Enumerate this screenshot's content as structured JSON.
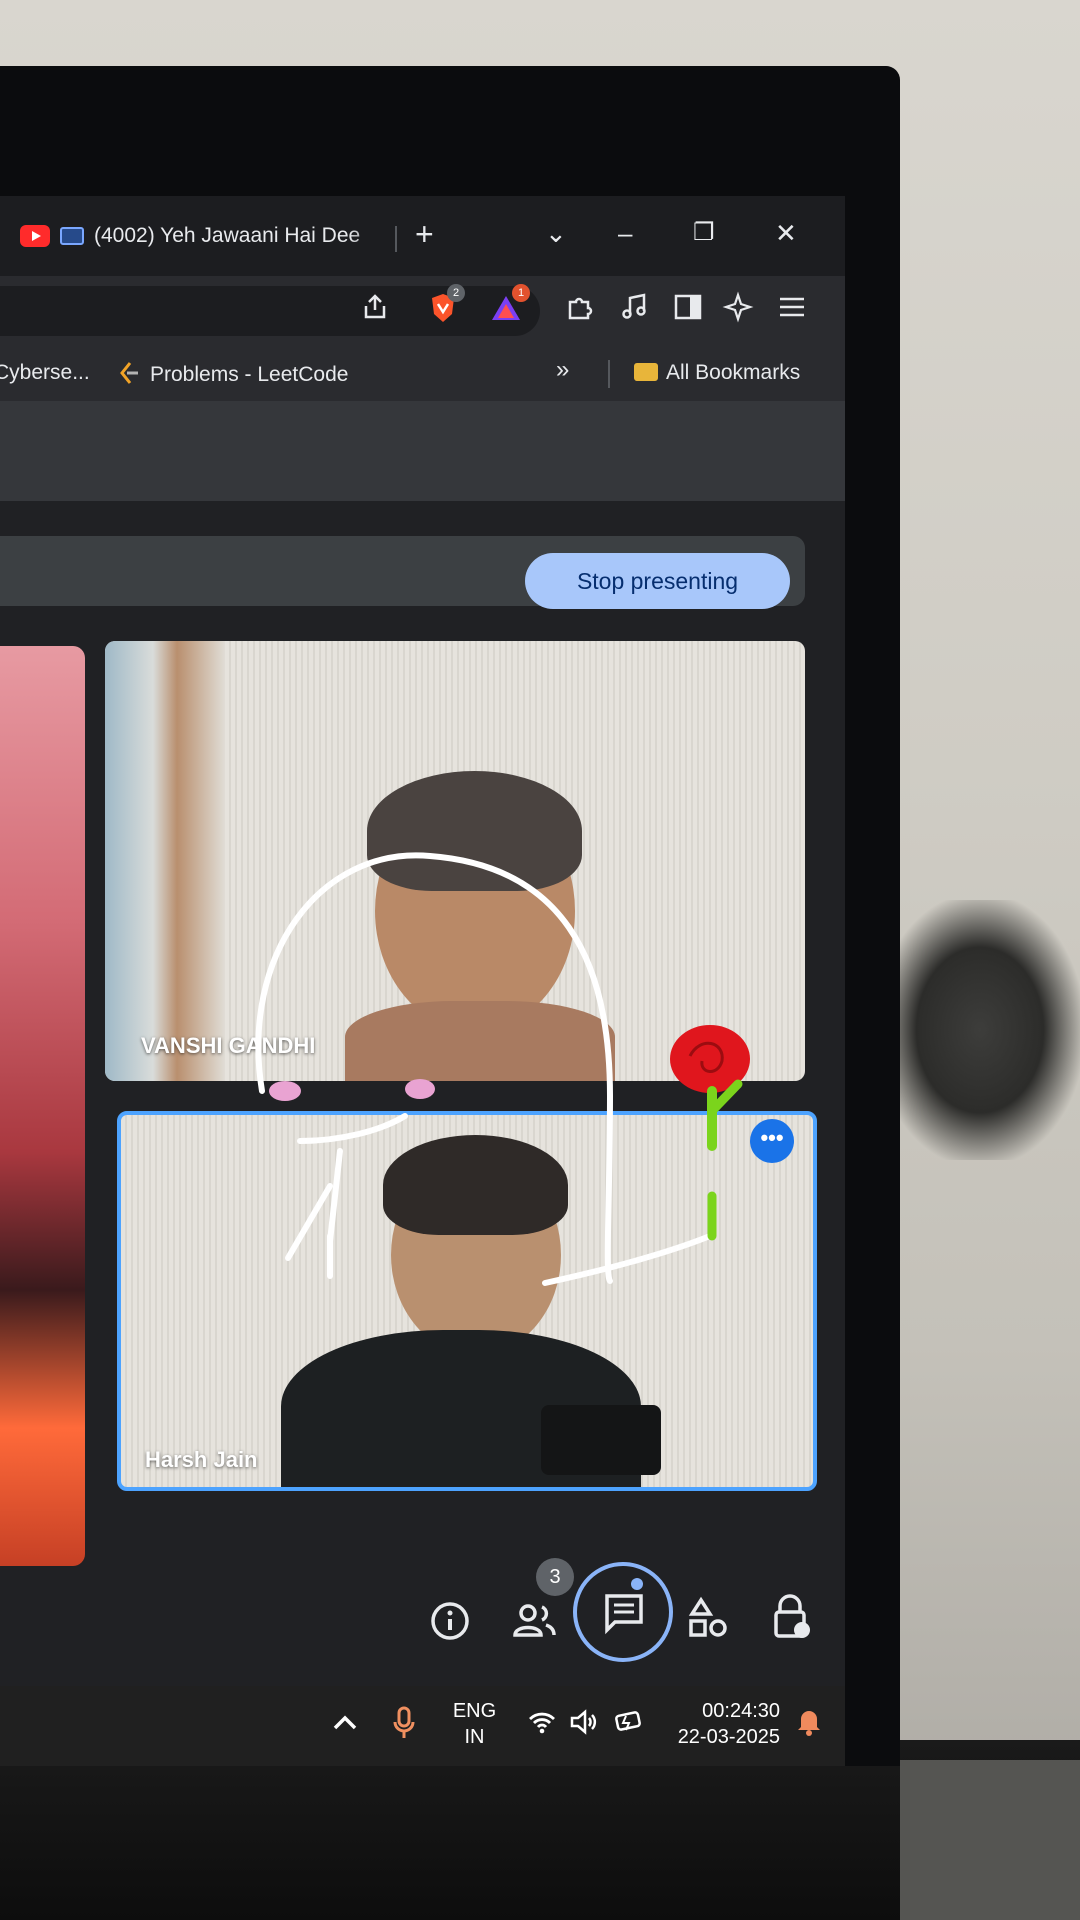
{
  "browser": {
    "tab_title": "(4002) Yeh Jawaani Hai Dee",
    "new_tab": "+",
    "tab_list": "⌄",
    "minimize": "–",
    "restore": "❐",
    "close": "✕",
    "brave_shield_count": "2",
    "rewards_count": "1"
  },
  "bookmarks": {
    "items": [
      "Cyberse...",
      "Problems - LeetCode"
    ],
    "overflow": "»",
    "all_bookmarks": "All Bookmarks"
  },
  "meet": {
    "stop_presenting": "Stop presenting",
    "participants": [
      {
        "name": "VANSHI GANDHI"
      },
      {
        "name": "Harsh Jain"
      }
    ],
    "more_options": "•••",
    "people_count": "3"
  },
  "taskbar": {
    "language_line1": "ENG",
    "language_line2": "IN",
    "time": "00:24:30",
    "date": "22-03-2025"
  },
  "colors": {
    "accent": "#a8c7fa",
    "active_tile_border": "#4da3ff",
    "rose": "#e0161d",
    "stem": "#7bd41c"
  }
}
